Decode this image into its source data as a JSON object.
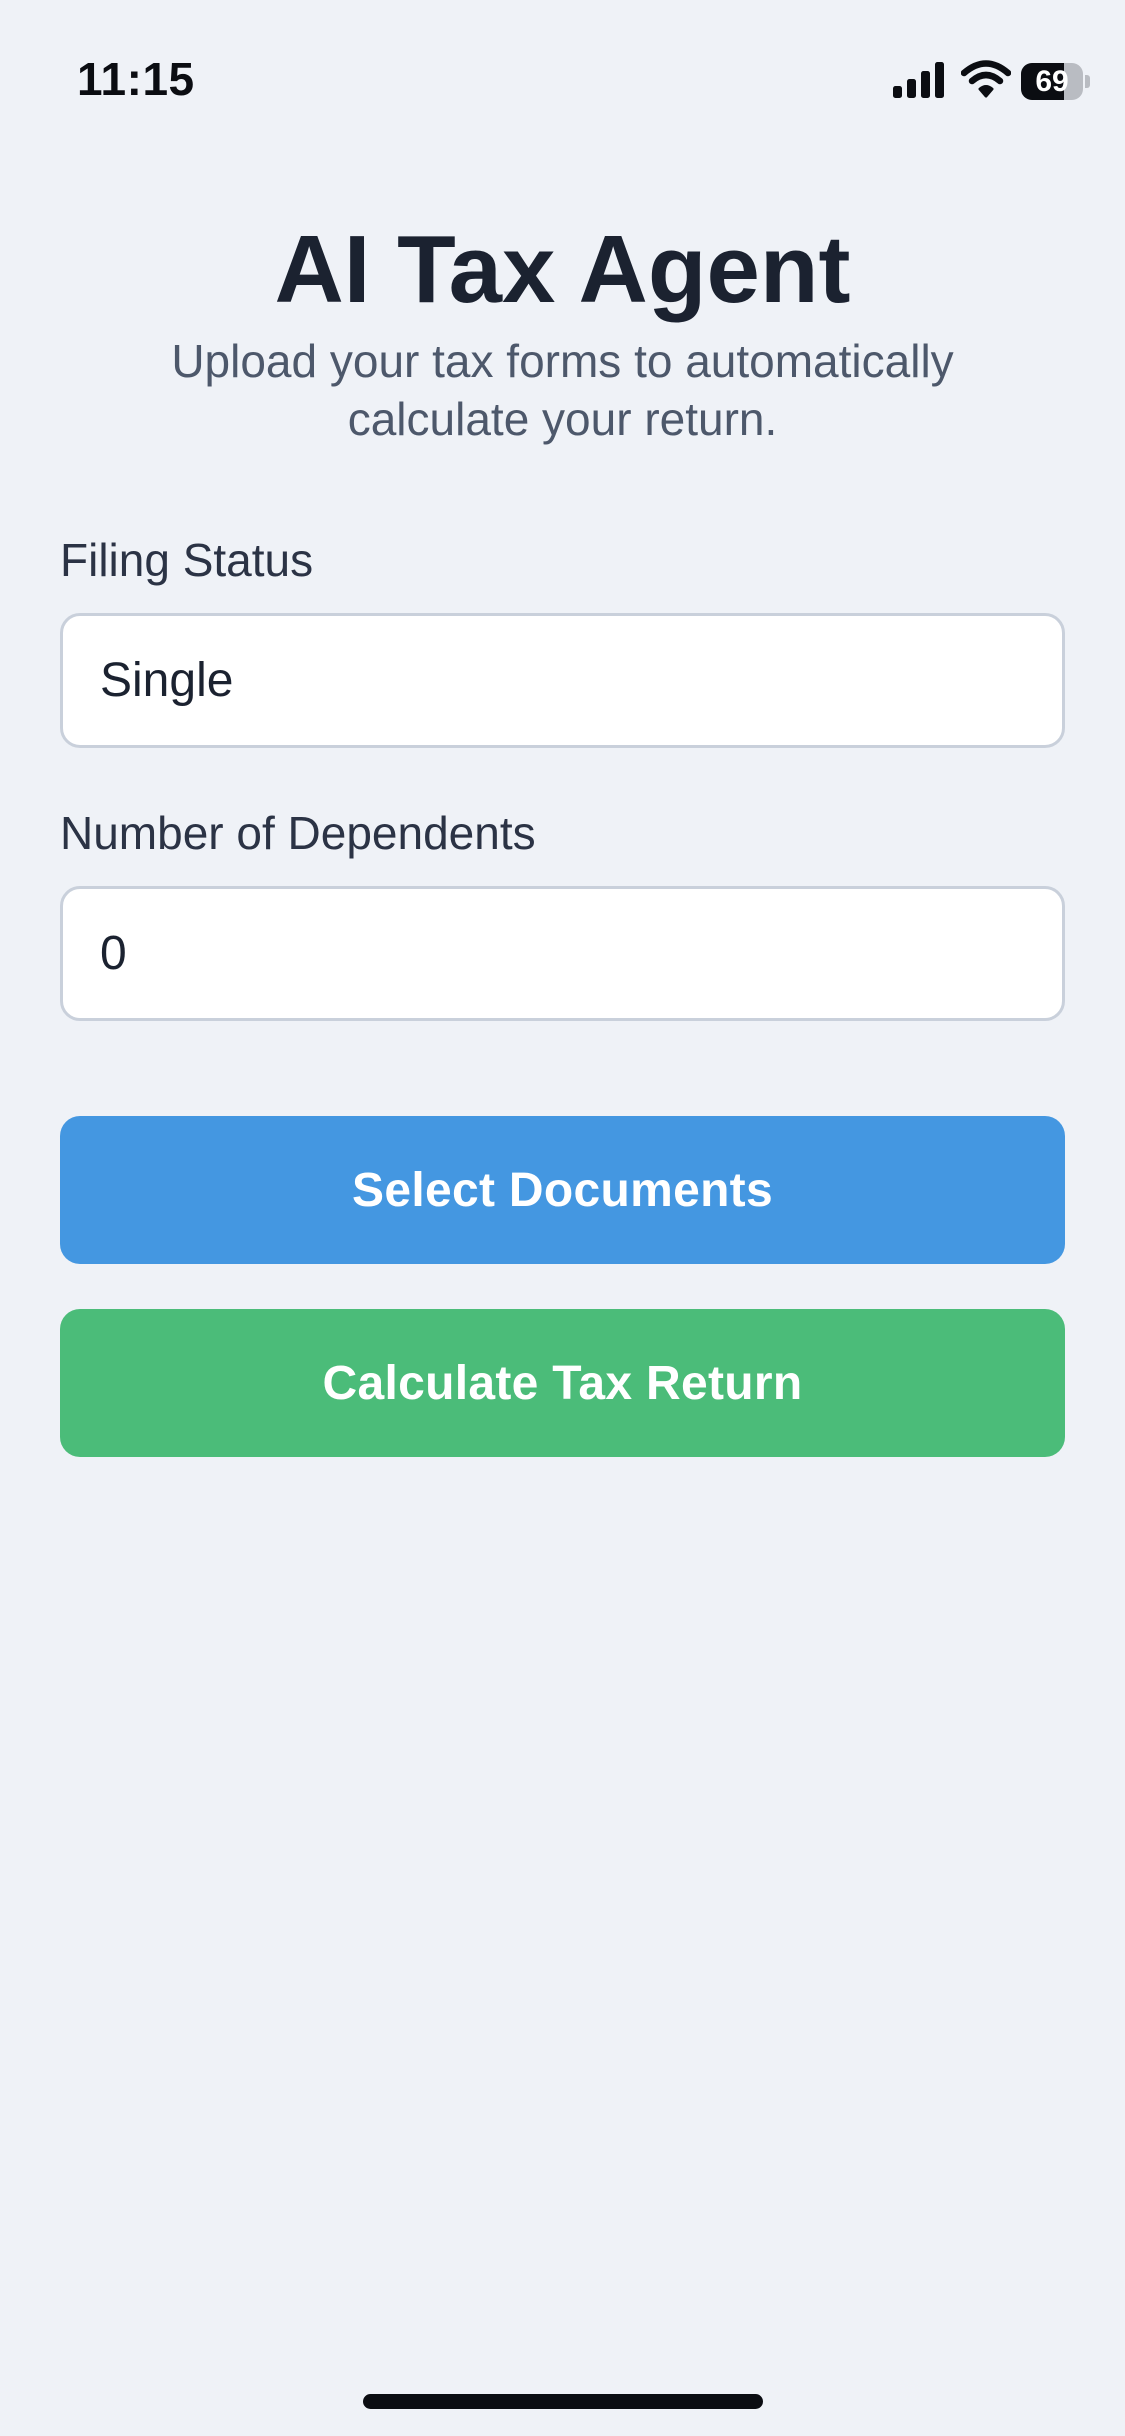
{
  "status_bar": {
    "time": "11:15",
    "battery_level": "69",
    "battery_fraction": 0.69,
    "icons": [
      "signal-icon",
      "wifi-icon",
      "battery-icon"
    ]
  },
  "header": {
    "title": "AI Tax Agent",
    "subtitle": "Upload your tax forms to automatically calculate your return."
  },
  "form": {
    "filing_status": {
      "label": "Filing Status",
      "value": "Single"
    },
    "dependents": {
      "label": "Number of Dependents",
      "value": "0"
    }
  },
  "actions": {
    "select_documents_label": "Select Documents",
    "calculate_label": "Calculate Tax Return"
  },
  "colors": {
    "background": "#eff2f7",
    "primary_blue": "#4497e1",
    "success_green": "#4bbc79",
    "title_text": "#1b2230",
    "input_border": "#c9d0db"
  }
}
